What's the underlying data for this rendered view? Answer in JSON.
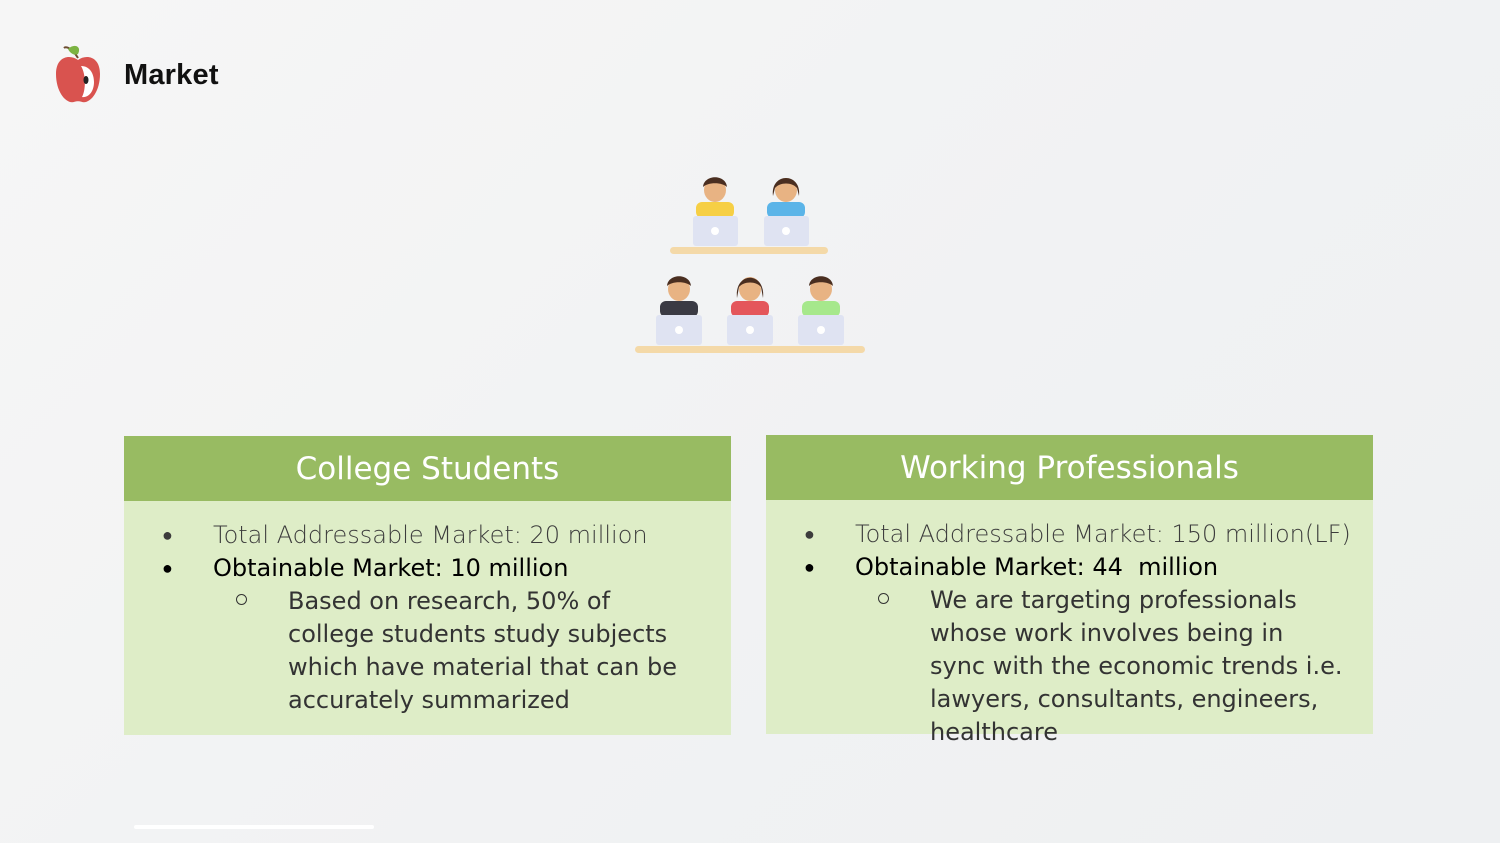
{
  "header": {
    "title": "Market"
  },
  "cards": [
    {
      "title": "College Students",
      "bullets": [
        "Total Addressable Market: 20 million",
        "Obtainable Market: 10 million"
      ],
      "sub": "Based on research, 50% of college students study subjects which have material that can be accurately summarized"
    },
    {
      "title": "Working Professionals",
      "bullets": [
        "Total Addressable Market: 150 million(LF)",
        "Obtainable Market: 44  million"
      ],
      "sub": "We are targeting professionals whose work involves being in sync with the economic trends i.e. lawyers, consultants, engineers, healthcare"
    }
  ],
  "colors": {
    "header_green": "#98bb62",
    "body_green": "#deedc7",
    "apple_red": "#d9534f"
  },
  "icons": [
    "apple-logo-icon",
    "classroom-people-illustration"
  ]
}
